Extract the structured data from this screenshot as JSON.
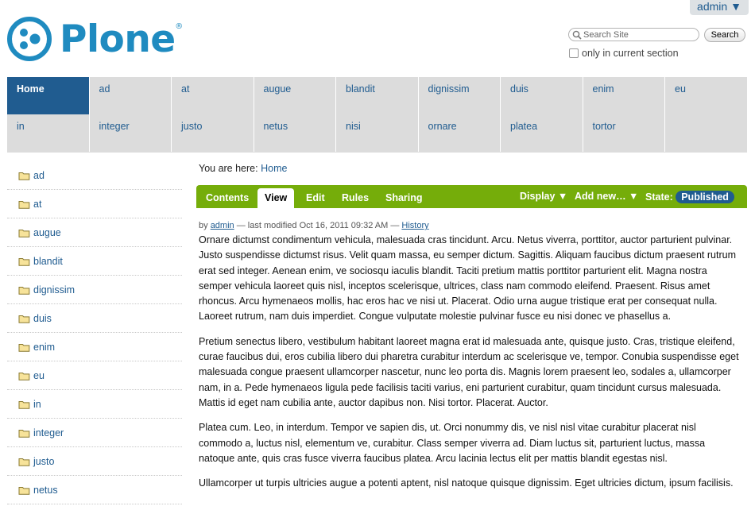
{
  "header": {
    "user_menu": "admin ▼",
    "logo_text": "Plone",
    "logo_mark": "®",
    "search_placeholder": "Search Site",
    "search_button": "Search",
    "section_only_label": "only in current section"
  },
  "global_nav": {
    "row1": [
      "Home",
      "ad",
      "at",
      "augue",
      "blandit",
      "dignissim",
      "duis",
      "enim",
      "eu"
    ],
    "row2": [
      "in",
      "integer",
      "justo",
      "netus",
      "nisi",
      "ornare",
      "platea",
      "tortor"
    ]
  },
  "left_nav": [
    "ad",
    "at",
    "augue",
    "blandit",
    "dignissim",
    "duis",
    "enim",
    "eu",
    "in",
    "integer",
    "justo",
    "netus"
  ],
  "breadcrumb": {
    "prefix": "You are here:",
    "home": "Home"
  },
  "edit_bar": {
    "tabs": [
      "Contents",
      "View",
      "Edit",
      "Rules",
      "Sharing"
    ],
    "display": "Display ▼",
    "add_new": "Add new… ▼",
    "state_label": "State:",
    "state_value": "Published"
  },
  "byline": {
    "by": "by",
    "author": "admin",
    "modified": "— last modified Oct 16, 2011 09:32 AM —",
    "history": "History"
  },
  "paragraphs": [
    "Ornare dictumst condimentum vehicula, malesuada cras tincidunt. Arcu. Netus viverra, porttitor, auctor parturient pulvinar. Justo suspendisse dictumst risus. Velit quam massa, eu semper dictum. Sagittis. Aliquam faucibus dictum praesent rutrum erat sed integer. Aenean enim, ve sociosqu iaculis blandit. Taciti pretium mattis porttitor parturient elit. Magna nostra semper vehicula laoreet quis nisl, inceptos scelerisque, ultrices, class nam commodo eleifend. Praesent. Risus amet rhoncus. Arcu hymenaeos mollis, hac eros hac ve nisi ut. Placerat. Odio urna augue tristique erat per consequat nulla. Laoreet rutrum, nam duis imperdiet. Congue vulputate molestie pulvinar fusce eu nisi donec ve phasellus a.",
    "Pretium senectus libero, vestibulum habitant laoreet magna erat id malesuada ante, quisque justo. Cras, tristique eleifend, curae faucibus dui, eros cubilia libero dui pharetra curabitur interdum ac scelerisque ve, tempor. Conubia suspendisse eget malesuada congue praesent ullamcorper nascetur, nunc leo porta dis. Magnis lorem praesent leo, sodales a, ullamcorper nam, in a. Pede hymenaeos ligula pede facilisis taciti varius, eni parturient curabitur, quam tincidunt cursus malesuada. Mattis id eget nam cubilia ante, auctor dapibus non. Nisi tortor. Placerat. Auctor.",
    "Platea cum. Leo, in interdum. Tempor ve sapien dis, ut. Orci nonummy dis, ve nisl nisl vitae curabitur placerat nisl commodo a, luctus nisl, elementum ve, curabitur. Class semper viverra ad. Diam luctus sit, parturient luctus, massa natoque ante, quis cras fusce viverra faucibus platea. Arcu lacinia lectus elit per mattis blandit egestas nisl.",
    "Ullamcorper ut turpis ultricies augue a potenti aptent, nisl natoque quisque dignissim. Eget ultricies dictum, ipsum facilisis."
  ]
}
